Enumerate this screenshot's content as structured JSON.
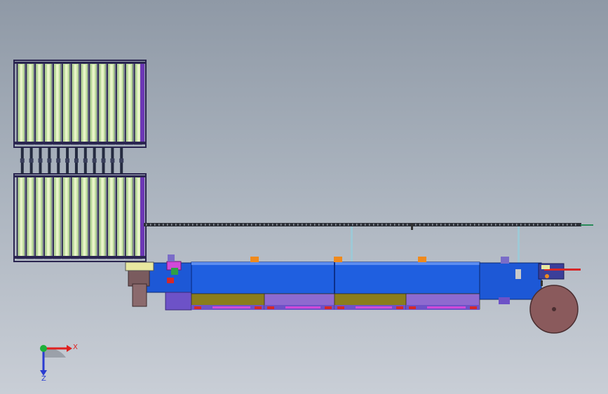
{
  "viewport": {
    "background_top": "#8f99a6",
    "background_bottom": "#c9ced6"
  },
  "model": {
    "rack": {
      "columns": 14,
      "frame_color": "#2a2550",
      "panel_color": "#b9d89a",
      "slat_color": "#e9f4c9",
      "accent_color": "#6c37b5"
    },
    "machine": {
      "body_color": "#1f5fe0",
      "body_dark": "#1442a8",
      "lower_color": "#8a7d1c",
      "lower_purple": "#8e6ad0",
      "frame_purple": "#6d52c7",
      "red_accent": "#d62828",
      "magenta_accent": "#d14ad8",
      "orange_accent": "#f08a1c",
      "green_accent": "#2ea043",
      "roller_color": "#8a5a5c"
    },
    "rail_color": "#2b2f36",
    "support_color": "#9ec9d6"
  },
  "triad": {
    "x_label": "X",
    "z_label": "Z",
    "x_color": "#e0201e",
    "y_color": "#1db13a",
    "z_color": "#2a3cd1"
  }
}
